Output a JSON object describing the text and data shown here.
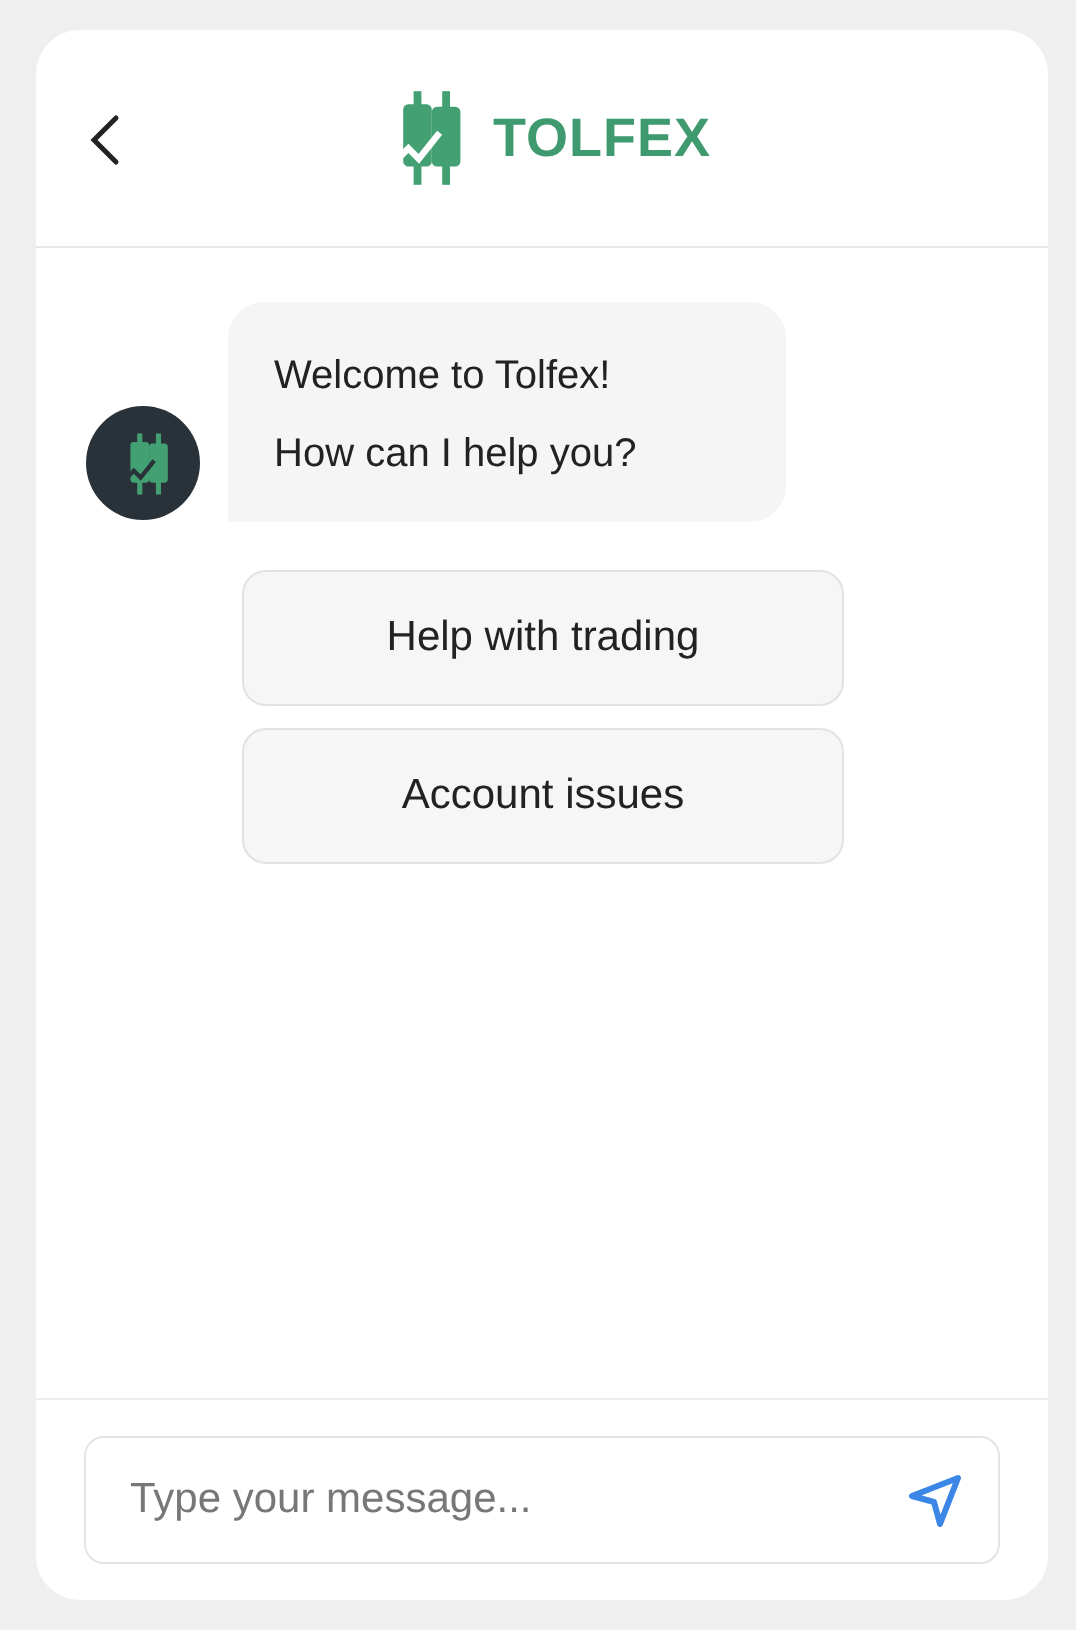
{
  "header": {
    "brand": "TOLFEX"
  },
  "messages": [
    {
      "lines": [
        "Welcome to Tolfex!",
        "How can I help you?"
      ]
    }
  ],
  "quick_replies": [
    "Help with trading",
    "Account issues"
  ],
  "composer": {
    "placeholder": "Type your message..."
  }
}
